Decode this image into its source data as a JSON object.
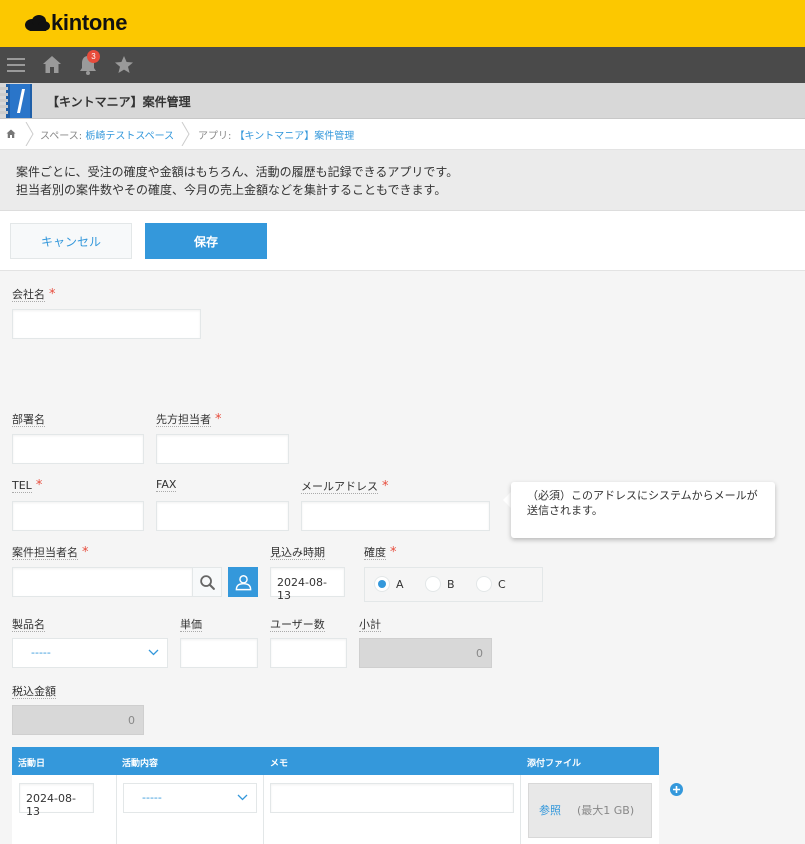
{
  "header": {
    "logo_text": "kintone",
    "notification_count": "3"
  },
  "app": {
    "title": "【キントマニア】案件管理"
  },
  "breadcrumb": {
    "space_prefix": "スペース: ",
    "space_name": "栃崎テストスペース",
    "app_prefix": "アプリ: ",
    "app_name": "【キントマニア】案件管理"
  },
  "description": {
    "line1": "案件ごとに、受注の確度や金額はもちろん、活動の履歴も記録できるアプリです。",
    "line2": "担当者別の案件数やその確度、今月の売上金額などを集計することもできます。"
  },
  "actions": {
    "cancel_label": "キャンセル",
    "save_label": "保存"
  },
  "form": {
    "company": {
      "label": "会社名",
      "required": "*"
    },
    "department": {
      "label": "部署名"
    },
    "contact": {
      "label": "先方担当者",
      "required": "*"
    },
    "tel": {
      "label": "TEL",
      "required": "*"
    },
    "fax": {
      "label": "FAX"
    },
    "email": {
      "label": "メールアドレス",
      "required": "*",
      "tooltip": "（必須）このアドレスにシステムからメールが送信されます。"
    },
    "owner": {
      "label": "案件担当者名",
      "required": "*"
    },
    "expected": {
      "label": "見込み時期",
      "value": "2024-08-13"
    },
    "certainty": {
      "label": "確度",
      "required": "*",
      "options": [
        "A",
        "B",
        "C"
      ],
      "selected": "A"
    },
    "product": {
      "label": "製品名",
      "value": "-----"
    },
    "unit_price": {
      "label": "単価"
    },
    "users": {
      "label": "ユーザー数"
    },
    "subtotal": {
      "label": "小計",
      "value": "0"
    },
    "total": {
      "label": "税込金額",
      "value": "0"
    }
  },
  "table": {
    "headers": {
      "date": "活動日",
      "content": "活動内容",
      "memo": "メモ",
      "attachment": "添付ファイル"
    },
    "row": {
      "date": "2024-08-13",
      "content": "-----",
      "browse": "参照",
      "max_size": "(最大1 GB)"
    }
  }
}
